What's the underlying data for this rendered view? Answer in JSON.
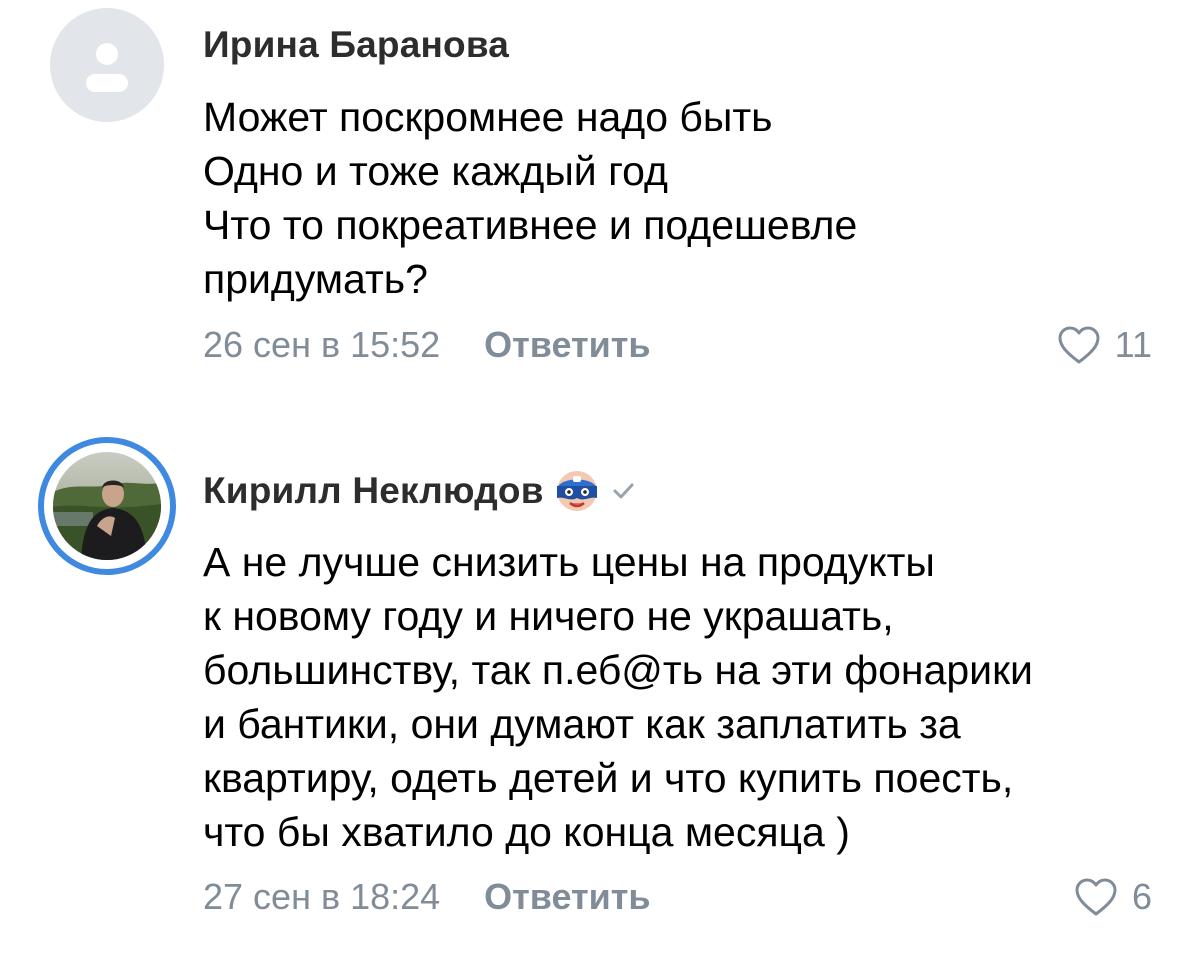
{
  "comments": [
    {
      "author": "Ирина Баранова",
      "text_lines": [
        "Может поскромнее надо быть",
        "Одно и тоже каждый год",
        "Что то покреативнее и подешевле",
        "придумать?"
      ],
      "date": "26 сен в 15:52",
      "reply_label": "Ответить",
      "likes": "11",
      "avatar_icon": "default-user-avatar-icon"
    },
    {
      "author": "Кирилл Неклюдов",
      "text_lines": [
        "А не лучше снизить цены на продукты",
        "к новому году и ничего не украшать,",
        "большинству, так п.еб@ть на эти фонарики",
        "и бантики, они думают как заплатить за",
        "квартиру, одеть детей и что купить поесть,",
        "что бы хватило до конца месяца )"
      ],
      "date": "27 сен в 18:24",
      "reply_label": "Ответить",
      "likes": "6",
      "avatar_icon": "user-photo-avatar",
      "badge_icon": "masked-hero-badge-icon",
      "verified_icon": "checkmark-icon"
    }
  ],
  "colors": {
    "text": "#000000",
    "author": "#2c2d2e",
    "secondary": "#818c99",
    "accent_ring": "#3f8ae0",
    "placeholder_bg": "#e2e5e9"
  }
}
